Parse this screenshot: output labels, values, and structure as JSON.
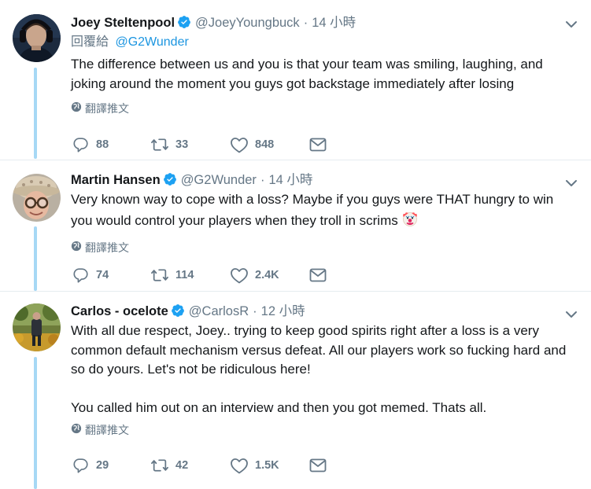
{
  "colors": {
    "accent": "#1b95e0",
    "secondary_text": "#657786",
    "primary_text": "#14171a",
    "thread_line": "#a6d8f5",
    "divider": "#e6ecf0"
  },
  "tweets": [
    {
      "name": "Joey Steltenpool",
      "handle": "@JoeyYoungbuck",
      "separator": "·",
      "time": "14 小時",
      "reply_prefix": "回覆給",
      "reply_handle": "@G2Wunder",
      "text": "The difference between us and you is that your team was smiling, laughing, and joking around the moment you guys got backstage immediately after losing",
      "translate_label": "翻譯推文",
      "replies": "88",
      "retweets": "33",
      "likes": "848",
      "icons": [
        "verified-badge-icon",
        "chevron-down-icon",
        "globe-icon",
        "reply-icon",
        "retweet-icon",
        "like-icon",
        "message-icon"
      ]
    },
    {
      "name": "Martin Hansen",
      "handle": "@G2Wunder",
      "separator": "·",
      "time": "14 小時",
      "text": "Very known way to cope with a loss? Maybe if you guys were THAT hungry to win you would control your players when they troll in scrims",
      "emoji": "clown-face-emoji",
      "translate_label": "翻譯推文",
      "replies": "74",
      "retweets": "114",
      "likes": "2.4K"
    },
    {
      "name": "Carlos - ocelote",
      "handle": "@CarlosR",
      "separator": "·",
      "time": "12 小時",
      "text": "With all due respect, Joey.. trying to keep good spirits right after a loss is a very common default mechanism versus defeat. All our players work so fucking hard and so do yours. Let's not be ridiculous here!\n\nYou called him out on an interview and then you got memed. Thats all.",
      "translate_label": "翻譯推文",
      "replies": "29",
      "retweets": "42",
      "likes": "1.5K"
    }
  ]
}
